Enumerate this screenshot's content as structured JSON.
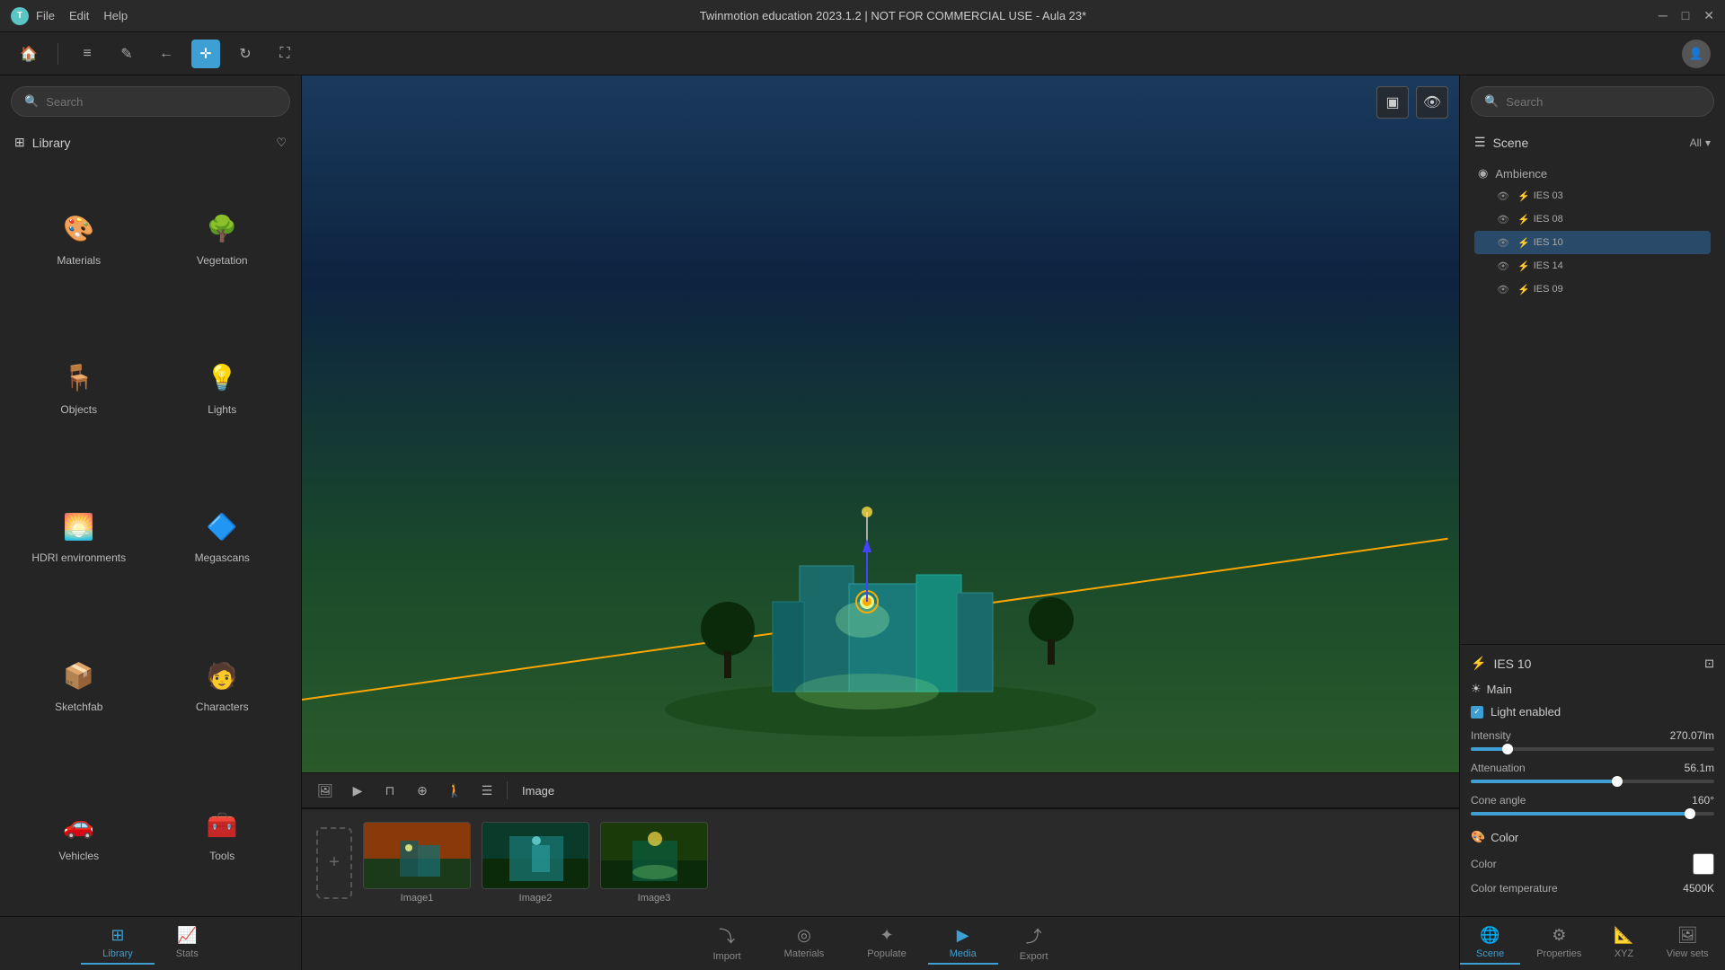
{
  "titlebar": {
    "logo": "T",
    "menu": [
      "File",
      "Edit",
      "Help"
    ],
    "title": "Twinmotion education 2023.1.2 | NOT FOR COMMERCIAL USE - Aula 23*",
    "controls": [
      "─",
      "□",
      "✕"
    ]
  },
  "toolbar": {
    "tools": [
      {
        "name": "align-icon",
        "glyph": "≡",
        "active": false
      },
      {
        "name": "pen-icon",
        "glyph": "✎",
        "active": false
      },
      {
        "name": "back-icon",
        "glyph": "←",
        "active": false
      },
      {
        "name": "move-icon",
        "glyph": "+",
        "active": true
      },
      {
        "name": "refresh-icon",
        "glyph": "↻",
        "active": false
      },
      {
        "name": "fullscreen-icon",
        "glyph": "⛶",
        "active": false
      }
    ],
    "user_icon": "👤"
  },
  "left_sidebar": {
    "search_placeholder": "Search",
    "library_label": "Library",
    "items": [
      {
        "id": "materials",
        "label": "Materials",
        "icon": "🎨"
      },
      {
        "id": "vegetation",
        "label": "Vegetation",
        "icon": "🌳"
      },
      {
        "id": "objects",
        "label": "Objects",
        "icon": "🪑"
      },
      {
        "id": "lights",
        "label": "Lights",
        "icon": "💡"
      },
      {
        "id": "hdri",
        "label": "HDRI environments",
        "icon": "🌅"
      },
      {
        "id": "megascans",
        "label": "Megascans",
        "icon": "🔷"
      },
      {
        "id": "sketchfab",
        "label": "Sketchfab",
        "icon": "📦"
      },
      {
        "id": "characters",
        "label": "Characters",
        "icon": "🧑"
      },
      {
        "id": "vehicles",
        "label": "Vehicles",
        "icon": "🚗"
      },
      {
        "id": "tools",
        "label": "Tools",
        "icon": "🧰"
      }
    ]
  },
  "bottom_nav_left": {
    "items": [
      {
        "id": "library",
        "label": "Library",
        "icon": "⊞",
        "active": true
      },
      {
        "id": "stats",
        "label": "Stats",
        "icon": "📈",
        "active": false
      }
    ]
  },
  "viewport": {
    "image_label": "Image",
    "media_items": [
      {
        "id": "image1",
        "label": "Image1"
      },
      {
        "id": "image2",
        "label": "Image2"
      },
      {
        "id": "image3",
        "label": "Image3"
      }
    ]
  },
  "bottom_nav_center": {
    "items": [
      {
        "id": "import",
        "label": "Import",
        "icon": "⤵"
      },
      {
        "id": "materials",
        "label": "Materials",
        "icon": "◎"
      },
      {
        "id": "populate",
        "label": "Populate",
        "icon": "✦"
      },
      {
        "id": "media",
        "label": "Media",
        "icon": "▶",
        "active": true
      },
      {
        "id": "export",
        "label": "Export",
        "icon": "⤴"
      }
    ]
  },
  "right_panel": {
    "search_placeholder": "Search",
    "scene_label": "Scene",
    "all_label": "All",
    "ambience_label": "Ambience",
    "tree_items": [
      {
        "id": "ies03",
        "label": "IES 03",
        "visible": true,
        "selected": false
      },
      {
        "id": "ies08",
        "label": "IES 08",
        "visible": true,
        "selected": false
      },
      {
        "id": "ies10",
        "label": "IES 10",
        "visible": true,
        "selected": true
      },
      {
        "id": "ies14",
        "label": "IES 14",
        "visible": true,
        "selected": false
      },
      {
        "id": "ies09",
        "label": "IES 09",
        "visible": true,
        "selected": false
      }
    ],
    "properties": {
      "selected_item": "IES 10",
      "main_label": "Main",
      "light_enabled_label": "Light enabled",
      "light_enabled": true,
      "intensity_label": "Intensity",
      "intensity_value": "270.07lm",
      "intensity_percent": 15,
      "attenuation_label": "Attenuation",
      "attenuation_value": "56.1m",
      "attenuation_percent": 60,
      "cone_angle_label": "Cone angle",
      "cone_angle_value": "160°",
      "cone_angle_percent": 90,
      "color_section_label": "Color",
      "color_label": "Color",
      "color_value": "#ffffff",
      "color_temperature_label": "Color temperature",
      "color_temperature_value": "4500K"
    }
  },
  "bottom_nav_right": {
    "items": [
      {
        "id": "scene",
        "label": "Scene",
        "icon": "🌐",
        "active": true
      },
      {
        "id": "properties",
        "label": "Properties",
        "icon": "⚙",
        "active": false
      },
      {
        "id": "xyz",
        "label": "XYZ",
        "icon": "📐",
        "active": false
      },
      {
        "id": "viewsets",
        "label": "View sets",
        "icon": "🖼",
        "active": false
      }
    ]
  }
}
